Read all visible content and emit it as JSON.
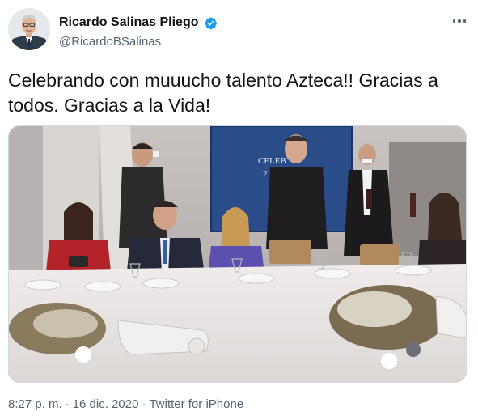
{
  "tweet": {
    "author": {
      "name": "Ricardo Salinas Pliego",
      "handle": "@RicardoBSalinas",
      "verified": true
    },
    "text": "Celebrando con muuucho talento Azteca!! Gracias a todos. Gracias a la Vida!",
    "media": {
      "screen_text_line1": "CELEB",
      "screen_text_line2": "2"
    },
    "meta": {
      "time": "8:27 p. m.",
      "separator": "·",
      "date": "16 dic. 2020",
      "source": "Twitter for iPhone"
    }
  },
  "colors": {
    "verified": "#1d9bf0",
    "text": "#0f1419",
    "secondary": "#536471"
  },
  "icons": [
    "verified-badge-icon",
    "more-options-icon"
  ]
}
